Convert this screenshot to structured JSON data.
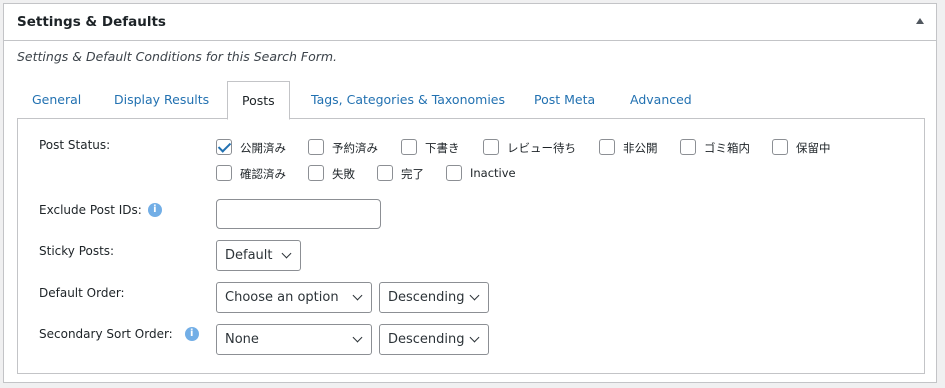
{
  "header": {
    "title": "Settings & Defaults",
    "toggle_icon": "triangle-up-icon"
  },
  "description": "Settings & Default Conditions for this Search Form.",
  "tabs": [
    {
      "label": "General",
      "active": false
    },
    {
      "label": "Display Results",
      "active": false
    },
    {
      "label": "Posts",
      "active": true
    },
    {
      "label": "Tags, Categories & Taxonomies",
      "active": false
    },
    {
      "label": "Post Meta",
      "active": false
    },
    {
      "label": "Advanced",
      "active": false
    }
  ],
  "post_status": {
    "label": "Post Status:",
    "options": [
      {
        "label": "公開済み",
        "checked": true
      },
      {
        "label": "予約済み",
        "checked": false
      },
      {
        "label": "下書き",
        "checked": false
      },
      {
        "label": "レビュー待ち",
        "checked": false
      },
      {
        "label": "非公開",
        "checked": false
      },
      {
        "label": "ゴミ箱内",
        "checked": false
      },
      {
        "label": "保留中",
        "checked": false
      },
      {
        "label": "確認済み",
        "checked": false
      },
      {
        "label": "失敗",
        "checked": false
      },
      {
        "label": "完了",
        "checked": false
      },
      {
        "label": "Inactive",
        "checked": false
      }
    ]
  },
  "exclude_ids": {
    "label": "Exclude Post IDs:",
    "value": "",
    "info_icon": "info-icon"
  },
  "sticky_posts": {
    "label": "Sticky Posts:",
    "value": "Default"
  },
  "default_order": {
    "label": "Default Order:",
    "field": "Choose an option",
    "direction": "Descending"
  },
  "secondary_order": {
    "label": "Secondary Sort Order:",
    "field": "None",
    "direction": "Descending",
    "info_icon": "info-icon"
  },
  "colors": {
    "link": "#2271b1",
    "border": "#c3c4c7",
    "info": "#72aee6",
    "background": "#f0f0f1"
  }
}
